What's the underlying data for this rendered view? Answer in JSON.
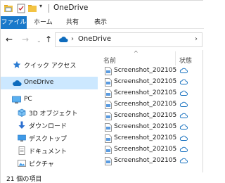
{
  "window": {
    "title": "OneDrive"
  },
  "ribbon": {
    "tabs": [
      {
        "label": "ファイル",
        "active": true
      },
      {
        "label": "ホーム",
        "active": false
      },
      {
        "label": "共有",
        "active": false
      },
      {
        "label": "表示",
        "active": false
      }
    ]
  },
  "address": {
    "path": "OneDrive"
  },
  "nav_pane": {
    "items": [
      {
        "label": "クイック アクセス",
        "icon": "star-icon"
      },
      {
        "label": "OneDrive",
        "icon": "cloud-icon",
        "selected": true
      },
      {
        "label": "PC",
        "icon": "pc-icon"
      },
      {
        "label": "3D オブジェクト",
        "icon": "3d-objects-icon"
      },
      {
        "label": "ダウンロード",
        "icon": "download-icon"
      },
      {
        "label": "デスクトップ",
        "icon": "desktop-icon"
      },
      {
        "label": "ドキュメント",
        "icon": "document-icon"
      },
      {
        "label": "ピクチャ",
        "icon": "picture-icon"
      }
    ]
  },
  "file_list": {
    "columns": {
      "name": "名前",
      "status": "状態"
    },
    "files": [
      {
        "name": "Screenshot_202105...",
        "status_icon": "cloud-status-icon"
      },
      {
        "name": "Screenshot_202105...",
        "status_icon": "cloud-status-icon"
      },
      {
        "name": "Screenshot_202105...",
        "status_icon": "cloud-status-icon"
      },
      {
        "name": "Screenshot_202105...",
        "status_icon": "cloud-status-icon"
      },
      {
        "name": "Screenshot_202105...",
        "status_icon": "cloud-status-icon"
      },
      {
        "name": "Screenshot_202105...",
        "status_icon": "cloud-status-icon"
      },
      {
        "name": "Screenshot_202105...",
        "status_icon": "cloud-status-icon"
      },
      {
        "name": "Screenshot_202105...",
        "status_icon": "cloud-status-icon"
      },
      {
        "name": "Screenshot_202105...",
        "status_icon": "cloud-status-icon"
      }
    ]
  },
  "status_bar": {
    "item_count": "21 個の項目"
  },
  "colors": {
    "file_tab_bg": "#1979ca",
    "selected_bg": "#cce8ff",
    "cloud_blue": "#0f6cbd"
  }
}
